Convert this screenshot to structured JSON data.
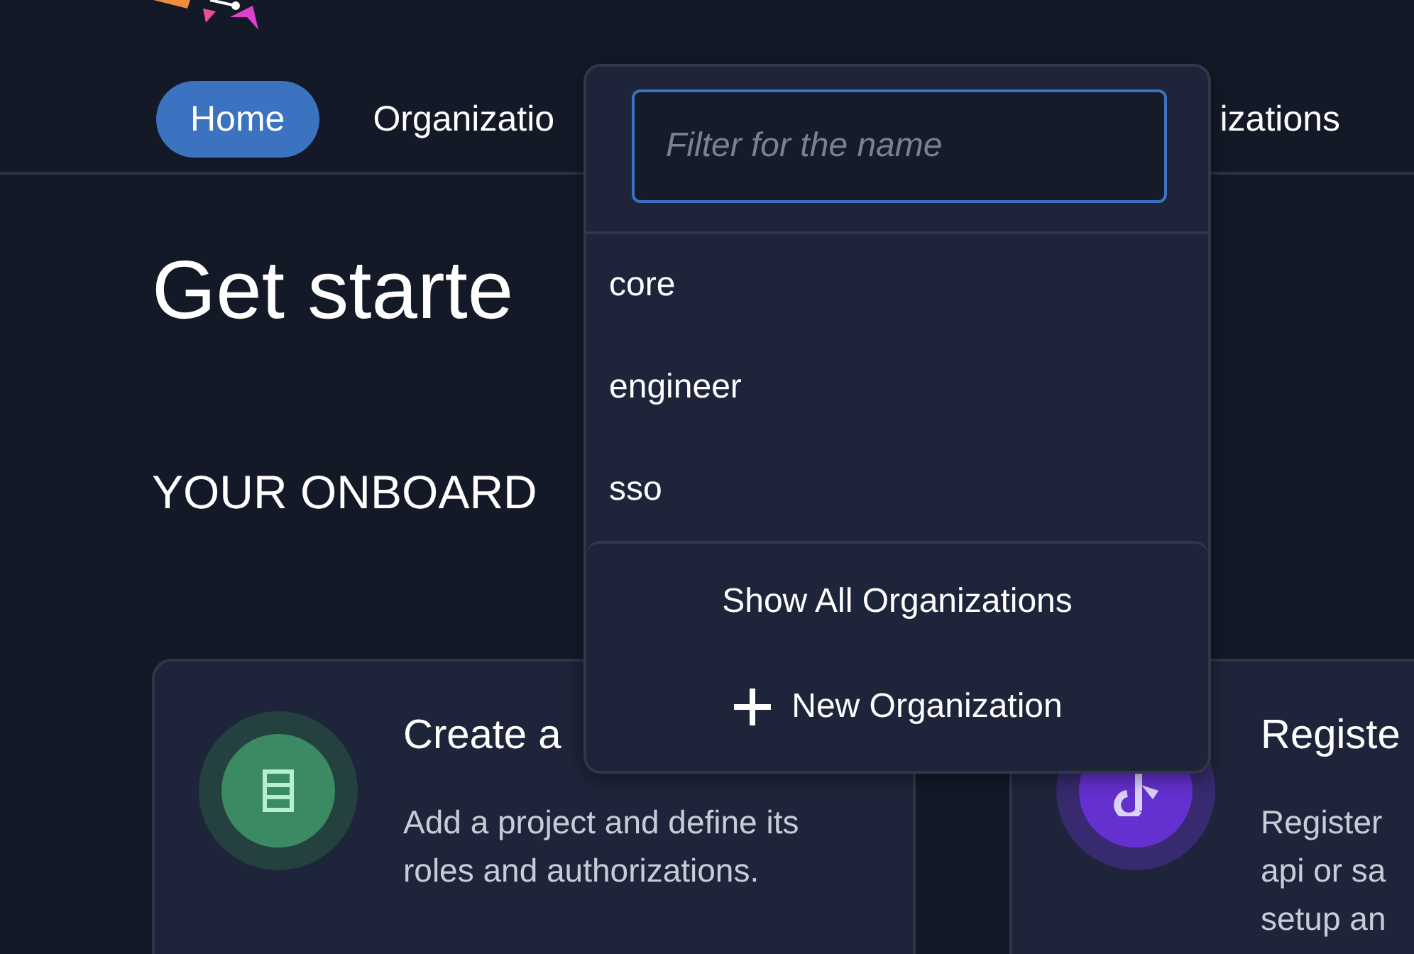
{
  "nav": {
    "tabs": [
      {
        "label": "Home",
        "selected": true
      },
      {
        "label": "Organizatio",
        "selected": false
      },
      {
        "label": "izations",
        "selected": false
      }
    ]
  },
  "page": {
    "title": "Get starte",
    "section_heading": "YOUR ONBOARD"
  },
  "cards": [
    {
      "kind": "project",
      "title": "Create a",
      "description_lines": [
        "Add a project and define its",
        "roles and authorizations."
      ]
    },
    {
      "kind": "app",
      "title": "Registe",
      "description_lines": [
        "Register",
        "api or sa",
        "setup an"
      ]
    }
  ],
  "org_dropdown": {
    "filter": {
      "placeholder": "Filter for the name"
    },
    "organizations": [
      {
        "name": "core"
      },
      {
        "name": "engineer"
      },
      {
        "name": "sso"
      }
    ],
    "actions": [
      {
        "kind": "show_all",
        "label": "Show All Organizations"
      },
      {
        "kind": "new",
        "label": "New Organization"
      }
    ]
  }
}
